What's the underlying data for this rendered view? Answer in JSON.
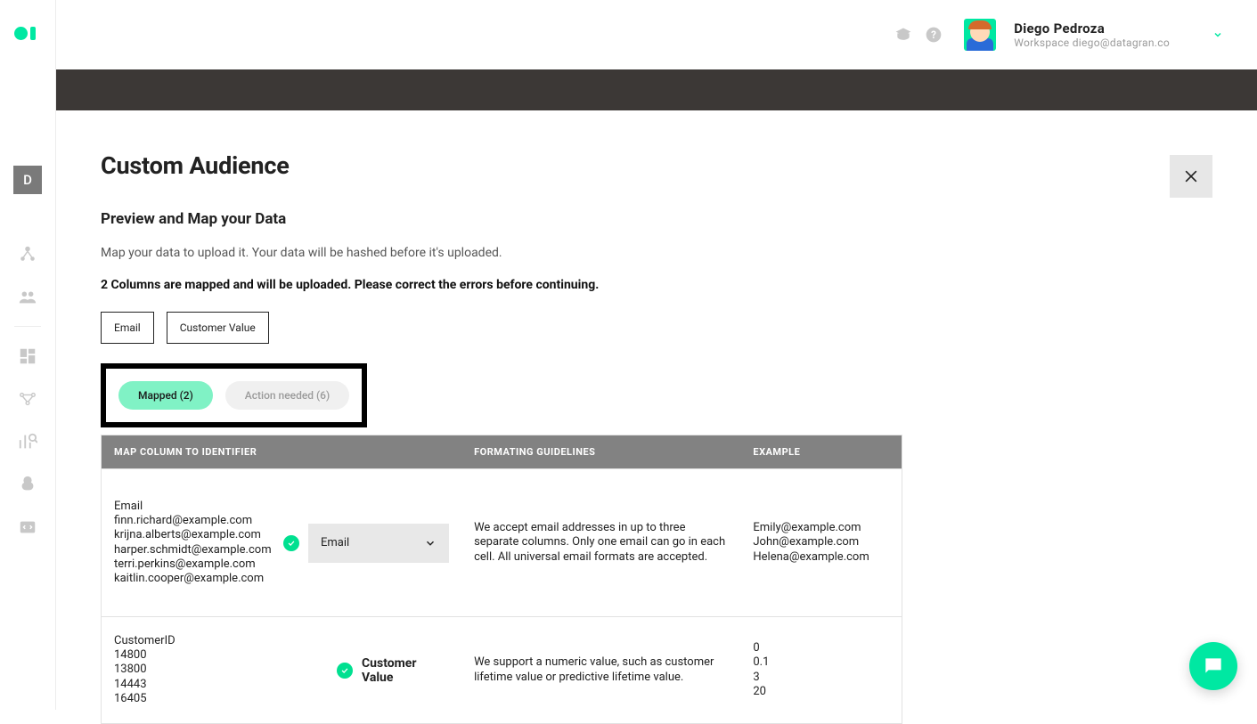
{
  "sidebar": {
    "workspace_letter": "D"
  },
  "header": {
    "user_name": "Diego Pedroza",
    "user_sub": "Workspace diego@datagran.co"
  },
  "page": {
    "title": "Custom Audience",
    "subtitle": "Preview and Map your Data",
    "description": "Map your data to upload it. Your data will be hashed before it's uploaded.",
    "status": "2 Columns are mapped and will be uploaded. Please correct the errors before continuing."
  },
  "chips": [
    "Email",
    "Customer Value"
  ],
  "tabs": {
    "mapped": "Mapped (2)",
    "action": "Action needed (6)"
  },
  "table": {
    "headers": {
      "col1": "MAP COLUMN TO IDENTIFIER",
      "col2": "FORMATING GUIDELINES",
      "col3": "EXAMPLE"
    },
    "rows": [
      {
        "col_label": "Email",
        "samples": [
          "finn.richard@example.com",
          "krijna.alberts@example.com",
          "harper.schmidt@example.com",
          "terri.perkins@example.com",
          "kaitlin.cooper@example.com"
        ],
        "select_value": "Email",
        "guideline": "We accept email addresses in up to three separate columns. Only one email can go in each cell. All universal email formats are accepted.",
        "example": "Emily@example.com\nJohn@example.com\nHelena@example.com"
      },
      {
        "col_label": "CustomerID",
        "samples": [
          "14800",
          "13800",
          "14443",
          "16405"
        ],
        "mapped_label": "Customer Value",
        "guideline": "We support a numeric value, such as customer lifetime value or predictive lifetime value.",
        "example": "0\n0.1\n3\n20"
      }
    ]
  }
}
